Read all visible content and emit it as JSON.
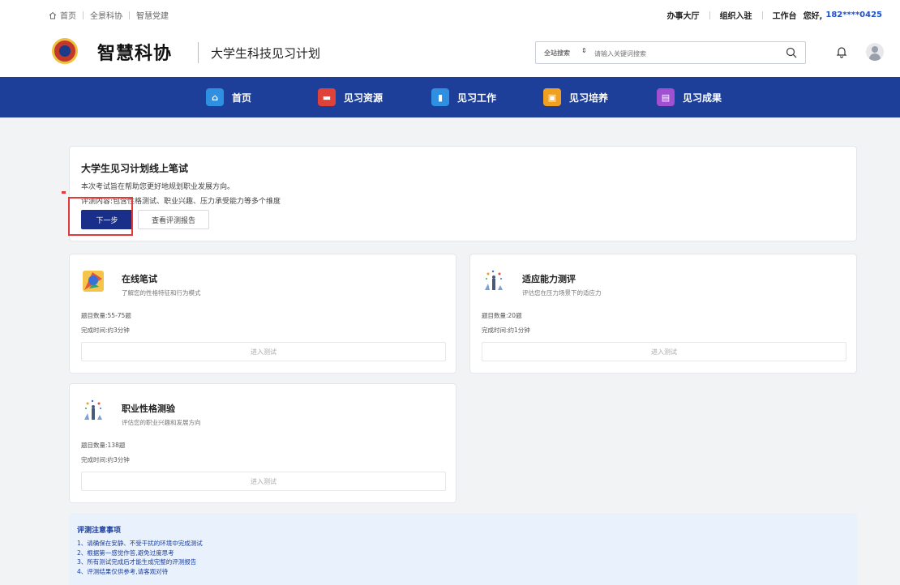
{
  "topbar": {
    "links": [
      "首页",
      "全景科协",
      "智慧党建"
    ],
    "right": [
      "办事大厅",
      "组织入驻",
      "工作台"
    ],
    "greeting": "您好,",
    "phone": "182****0425"
  },
  "header": {
    "brand": "智慧科协",
    "subtitle": "大学生科技见习计划",
    "search_scope": "全站搜索",
    "search_placeholder": "请输入关键词搜索"
  },
  "nav": {
    "items": [
      {
        "label": "首页",
        "icon": "home-icon",
        "color": "#2f8fe0"
      },
      {
        "label": "见习资源",
        "icon": "car-icon",
        "color": "#e0423a"
      },
      {
        "label": "见习工作",
        "icon": "chart-icon",
        "color": "#2f8fe0"
      },
      {
        "label": "见习培养",
        "icon": "clipboard-icon",
        "color": "#f0a020"
      },
      {
        "label": "见习成果",
        "icon": "document-icon",
        "color": "#a050d0"
      }
    ]
  },
  "intro": {
    "title": "大学生见习计划线上笔试",
    "desc1": "本次考试旨在帮助您更好地规划职业发展方向。",
    "desc2": "评测内容:包含性格测试、职业兴趣、压力承受能力等多个维度",
    "next_label": "下一步",
    "report_label": "查看评测报告"
  },
  "tests": [
    {
      "name": "在线笔试",
      "desc": "了解您的性格特征和行为模式",
      "count": "题目数量:55-75题",
      "time": "完成时间:约3分钟",
      "button": "进入测试"
    },
    {
      "name": "适应能力测评",
      "desc": "评估您在压力场景下的适应力",
      "count": "题目数量:20题",
      "time": "完成时间:约1分钟",
      "button": "进入测试"
    },
    {
      "name": "职业性格测验",
      "desc": "评估您的职业兴趣和发展方向",
      "count": "题目数量:138题",
      "time": "完成时间:约3分钟",
      "button": "进入测试"
    }
  ],
  "notes": {
    "title": "评测注意事项",
    "items": [
      "1、请确保在安静、不受干扰的环境中完成测试",
      "2、根据第一感觉作答,避免过度思考",
      "3、所有测试完成后才能生成完整的评测报告",
      "4、评测结果仅供参考,请客观对待"
    ]
  }
}
